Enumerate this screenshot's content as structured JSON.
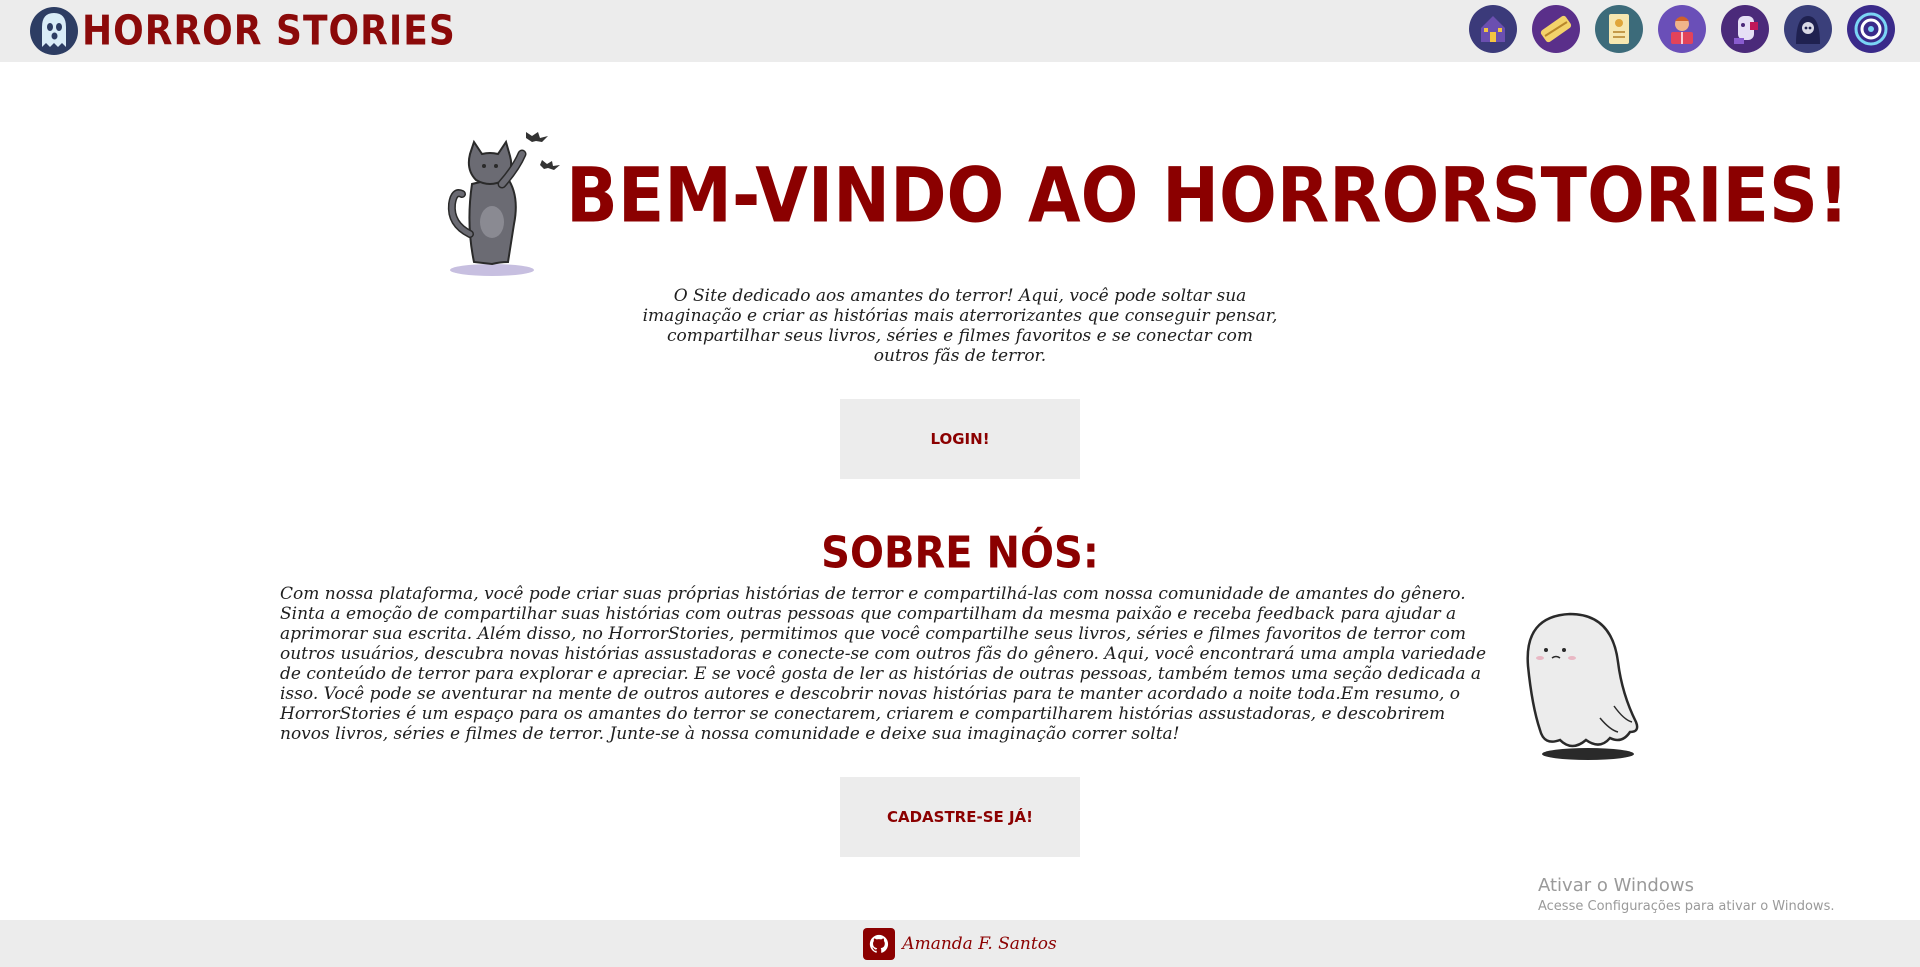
{
  "header": {
    "brand_title": "HORROR STORIES",
    "nav_icons": [
      "haunted-house-icon",
      "ouija-icon",
      "scroll-icon",
      "reader-icon",
      "specter-icon",
      "reaper-icon",
      "vortex-icon"
    ]
  },
  "hero": {
    "title": "BEM-VINDO AO HORRORSTORIES!",
    "intro": "O Site dedicado aos amantes do terror! Aqui, você pode soltar sua imaginação e criar as histórias mais aterrorizantes que conseguir pensar, compartilhar seus livros, séries e filmes favoritos e se conectar com outros fãs de terror.",
    "login_label": "LOGIN!"
  },
  "about": {
    "title": "SOBRE NÓS:",
    "text": "Com nossa plataforma, você pode criar suas próprias histórias de terror e compartilhá-las com nossa comunidade de amantes do gênero. Sinta a emoção de compartilhar suas histórias com outras pessoas que compartilham da mesma paixão e receba feedback para ajudar a aprimorar sua escrita. Além disso, no HorrorStories, permitimos que você compartilhe seus livros, séries e filmes favoritos de terror com outros usuários, descubra novas histórias assustadoras e conecte-se com outros fãs do gênero. Aqui, você encontrará uma ampla variedade de conteúdo de terror para explorar e apreciar. E se você gosta de ler as histórias de outras pessoas, também temos uma seção dedicada a isso. Você pode se aventurar na mente de outros autores e descobrir novas histórias para te manter acordado a noite toda.Em resumo, o HorrorStories é um espaço para os amantes do terror se conectarem, criarem e compartilharem histórias assustadoras, e descobrirem novos livros, séries e filmes de terror. Junte-se à nossa comunidade e deixe sua imaginação correr solta!",
    "signup_label": "CADASTRE-SE JÁ!"
  },
  "watermark": {
    "title": "Ativar o Windows",
    "subtitle": "Acesse Configurações para ativar o Windows."
  },
  "footer": {
    "author": "Amanda F. Santos"
  },
  "colors": {
    "brand_red": "#8b0000",
    "bar_gray": "#ececec",
    "text_dark": "#1e1e1e"
  }
}
